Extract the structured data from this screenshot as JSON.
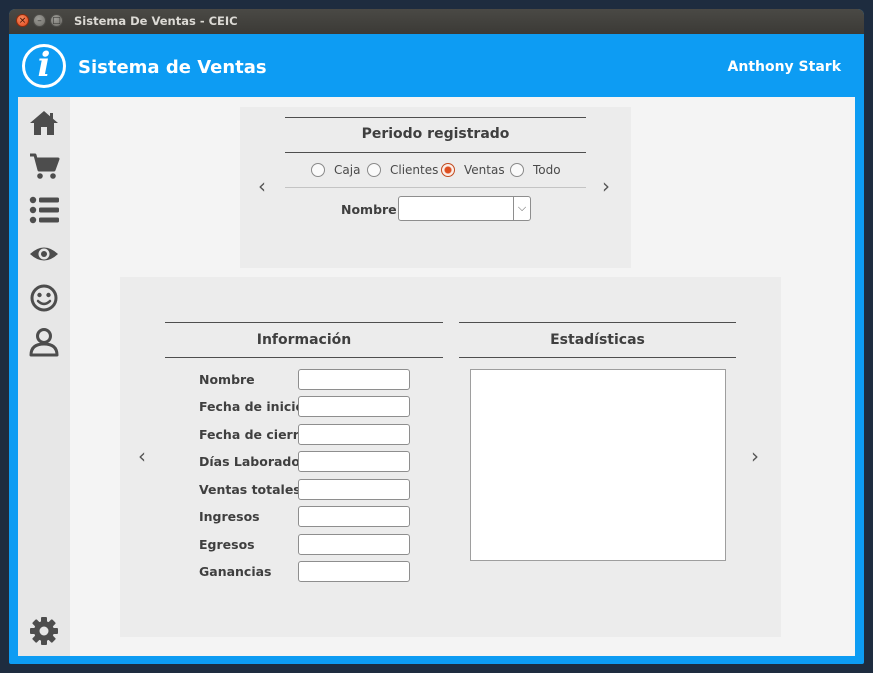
{
  "window": {
    "title": "Sistema De Ventas - CEIC"
  },
  "header": {
    "logo": "i",
    "title": "Sistema de Ventas",
    "user": "Anthony Stark"
  },
  "sidebar": {
    "icons": [
      "home-icon",
      "cart-icon",
      "list-icon",
      "eye-icon",
      "smiley-icon",
      "user-icon",
      "gear-icon"
    ]
  },
  "periodo": {
    "title": "Periodo registrado",
    "options": [
      "Caja",
      "Clientes",
      "Ventas",
      "Todo"
    ],
    "selected": "Ventas",
    "nombre_label": "Nombre",
    "nombre_value": ""
  },
  "informacion": {
    "title": "Información",
    "fields": [
      "Nombre",
      "Fecha de inicio",
      "Fecha de cierre",
      "Días Laborados",
      "Ventas totales",
      "Ingresos",
      "Egresos",
      "Ganancias"
    ]
  },
  "estadisticas": {
    "title": "Estadísticas"
  },
  "colors": {
    "header_blue": "#0d9cf3",
    "radio_accent": "#de4e20"
  }
}
